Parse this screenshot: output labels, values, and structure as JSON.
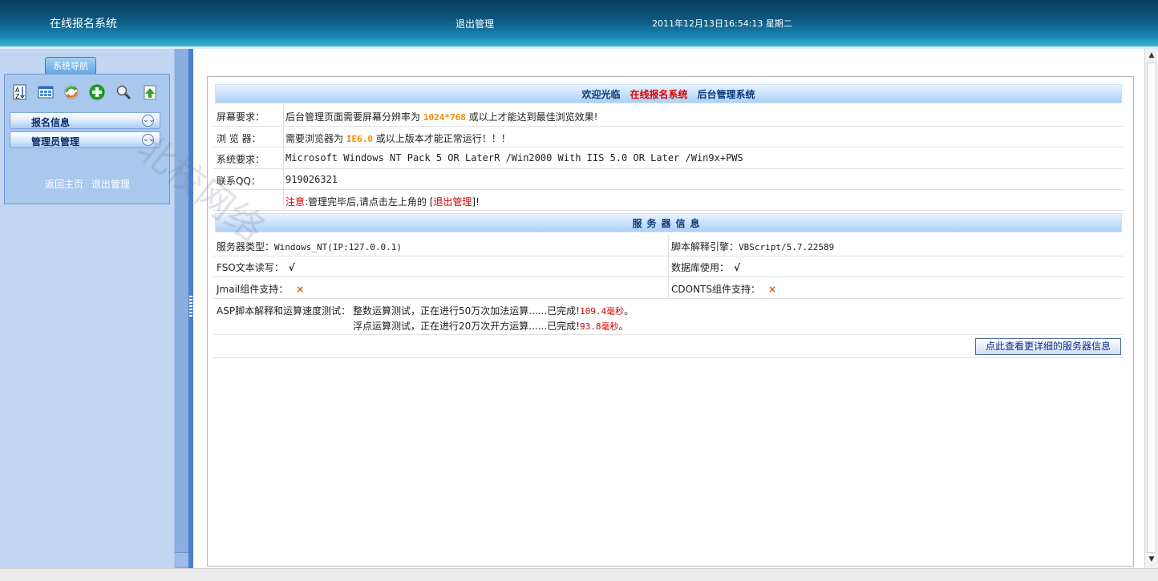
{
  "header": {
    "title": "在线报名系统",
    "logout": "退出管理",
    "datetime": "2011年12月13日16:54:13 星期二"
  },
  "sidebar": {
    "tab_label": "系统导航",
    "toolbar_icons": [
      "sort-az-icon",
      "grid-icon",
      "refresh-icon",
      "add-icon",
      "search-icon",
      "upload-icon"
    ],
    "menu": [
      {
        "label": "报名信息"
      },
      {
        "label": "管理员管理"
      }
    ],
    "links": {
      "home": "返回主页",
      "logout": "退出管理"
    }
  },
  "welcome": {
    "prefix": "欢迎光临",
    "system": "在线报名系统",
    "suffix": "后台管理系统"
  },
  "info": {
    "screen_label": "屏幕要求：",
    "screen_pre": "后台管理页面需要屏幕分辨率为",
    "screen_res": "1024*768",
    "screen_post": "或以上才能达到最佳浏览效果!",
    "browser_label": "浏 览 器：",
    "browser_pre": "需要浏览器为",
    "browser_ver": "IE6.0",
    "browser_post": "或以上版本才能正常运行！！！",
    "system_label": "系统要求：",
    "system_value": "Microsoft Windows NT Pack 5 OR LaterR /Win2000 With IIS 5.0 OR Later /Win9x+PWS",
    "qq_label": "联系QQ：",
    "qq_value": "919026321",
    "note_label": "注意",
    "note_pre": ":管理完毕后,请点击左上角的 [",
    "note_link": "退出管理",
    "note_post": "]!"
  },
  "server": {
    "title": "服务器信息",
    "type_label": "服务器类型：",
    "type_value": "Windows_NT(IP:127.0.0.1)",
    "engine_label": "脚本解释引擎：",
    "engine_value": "VBScript/5.7.22589",
    "fso_label": "FSO文本读写：",
    "fso_value": "√",
    "db_label": "数据库使用：",
    "db_value": "√",
    "jmail_label": "Jmail组件支持：",
    "jmail_value": "×",
    "cdonts_label": "CDONTS组件支持：",
    "cdonts_value": "×",
    "speed_label": "ASP脚本解释和运算速度测试：",
    "int_test": "整数运算测试，正在进行50万次加法运算......已完成!",
    "int_time": "109.4毫秒",
    "float_test": "浮点运算测试，正在进行20万次开方运算......已完成!",
    "float_time": "93.8毫秒",
    "period": "。",
    "detail_button": "点此查看更详细的服务器信息"
  },
  "watermark": "北校网络"
}
